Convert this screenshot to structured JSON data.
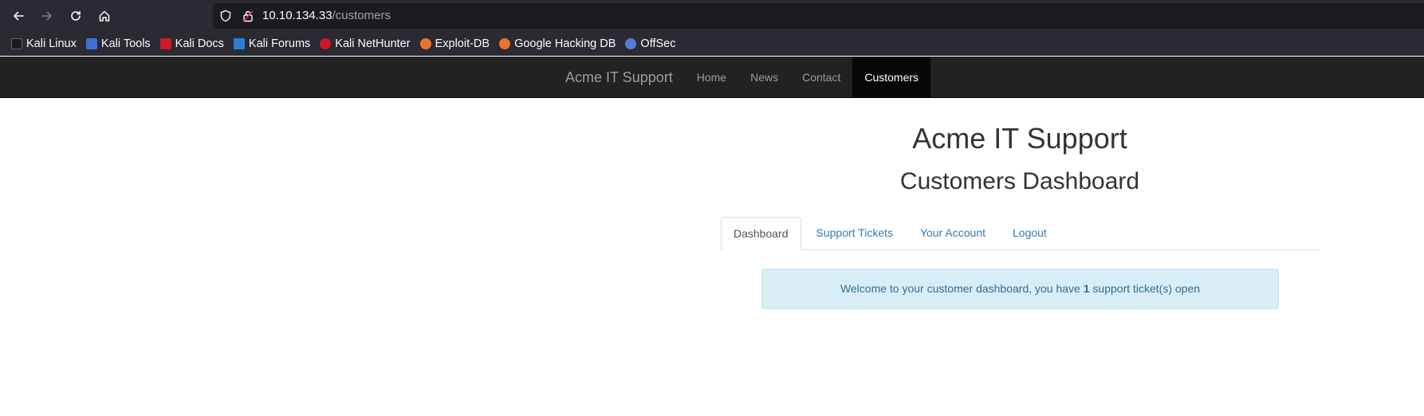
{
  "browser": {
    "url_host": "10.10.134.33",
    "url_path": "/customers",
    "bookmarks": [
      {
        "label": "Kali Linux",
        "icon": "kali-dragon-icon",
        "color": "#1a1a1a"
      },
      {
        "label": "Kali Tools",
        "icon": "kali-tools-icon",
        "color": "#3d6fd6"
      },
      {
        "label": "Kali Docs",
        "icon": "kali-docs-icon",
        "color": "#d0172b"
      },
      {
        "label": "Kali Forums",
        "icon": "kali-forums-icon",
        "color": "#2a7fd4"
      },
      {
        "label": "Kali NetHunter",
        "icon": "kali-nethunter-icon",
        "color": "#d0172b"
      },
      {
        "label": "Exploit-DB",
        "icon": "exploit-db-icon",
        "color": "#e9742e"
      },
      {
        "label": "Google Hacking DB",
        "icon": "ghdb-icon",
        "color": "#e9742e"
      },
      {
        "label": "OffSec",
        "icon": "offsec-icon",
        "color": "#4f7ed6"
      }
    ]
  },
  "navbar": {
    "brand": "Acme IT Support",
    "links": [
      {
        "label": "Home",
        "active": false
      },
      {
        "label": "News",
        "active": false
      },
      {
        "label": "Contact",
        "active": false
      },
      {
        "label": "Customers",
        "active": true
      }
    ]
  },
  "main": {
    "title": "Acme IT Support",
    "subtitle": "Customers Dashboard",
    "tabs": [
      {
        "label": "Dashboard",
        "active": true
      },
      {
        "label": "Support Tickets",
        "active": false
      },
      {
        "label": "Your Account",
        "active": false
      },
      {
        "label": "Logout",
        "active": false
      }
    ],
    "alert": {
      "prefix": "Welcome to your customer dashboard, you have ",
      "count": "1",
      "suffix": " support ticket(s) open"
    }
  }
}
